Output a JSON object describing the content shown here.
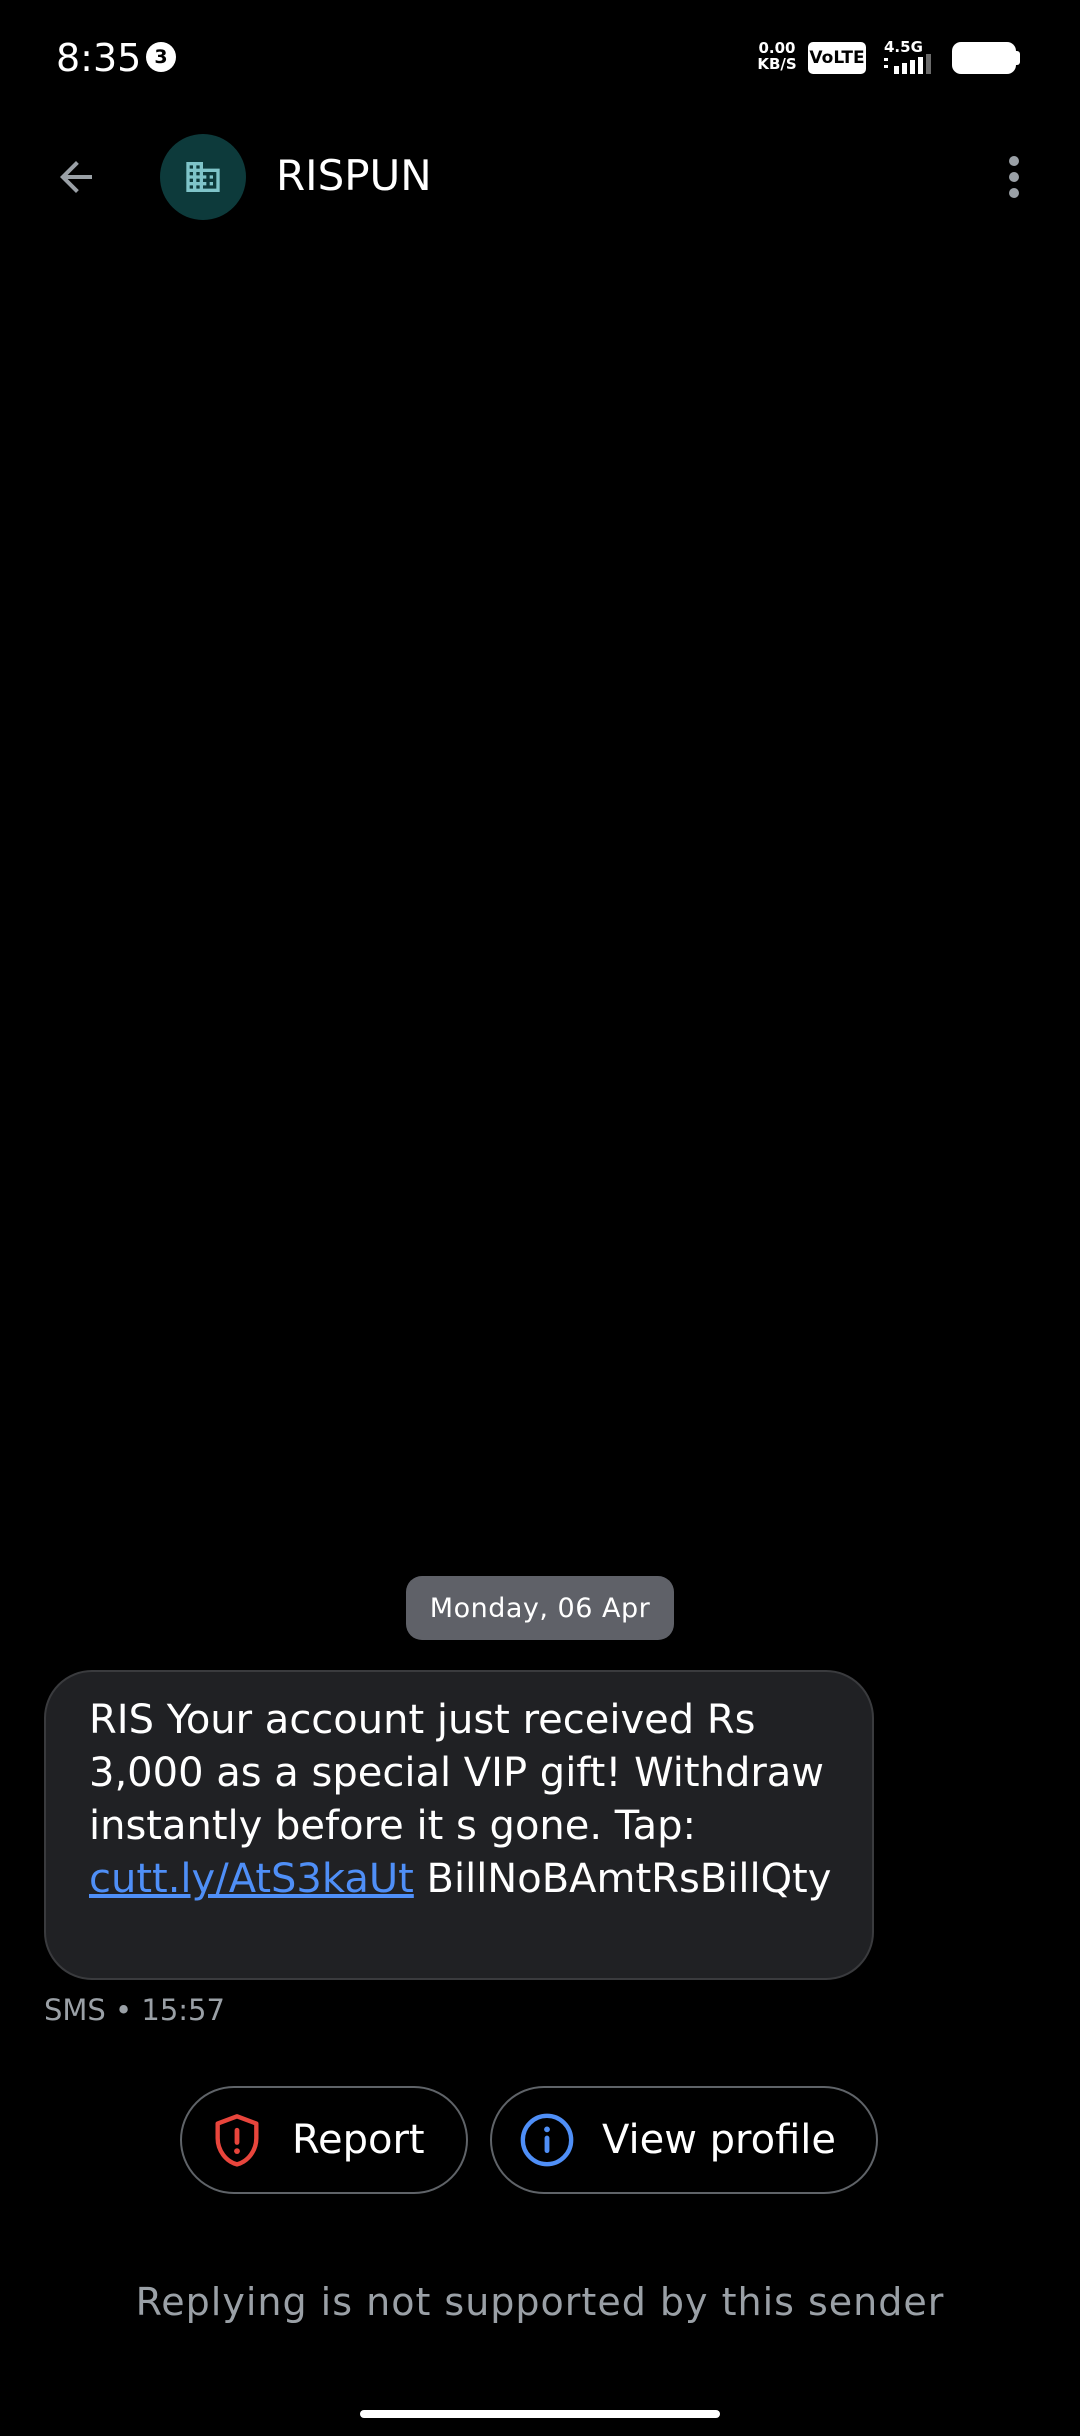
{
  "status_bar": {
    "time": "8:35",
    "notification_count": "3",
    "net_speed_value": "0.00",
    "net_speed_unit": "KB/S",
    "volte_label": "VoLTE",
    "network_label": "4.5G",
    "battery_icon": "battery-icon"
  },
  "header": {
    "back_icon": "arrow-back-icon",
    "avatar_icon": "building-icon",
    "sender_name": "RISPUN",
    "menu_icon": "more-vert-icon"
  },
  "conversation": {
    "date_chip": "Monday, 06 Apr",
    "message": {
      "text_before_link": "RIS Your account just received Rs 3,000 as a special VIP gift! Withdraw instantly before it s gone. Tap: ",
      "link": "cutt.ly/AtS3kaUt",
      "text_after_link": " BillNoBAmtRsBillQty",
      "meta": "SMS • 15:57"
    }
  },
  "actions": {
    "report_label": "Report",
    "report_icon": "shield-alert-icon",
    "view_profile_label": "View profile",
    "view_profile_icon": "info-icon"
  },
  "footer": {
    "reply_note": "Replying is not supported by this sender"
  },
  "colors": {
    "background": "#000000",
    "bubble": "#202124",
    "link": "#4f8ff7",
    "avatar_bg": "#0d3a3b",
    "avatar_icon": "#7fc4c9",
    "report_red": "#e8453c",
    "info_blue": "#4f8ff7",
    "muted_text": "#9aa0a6"
  }
}
